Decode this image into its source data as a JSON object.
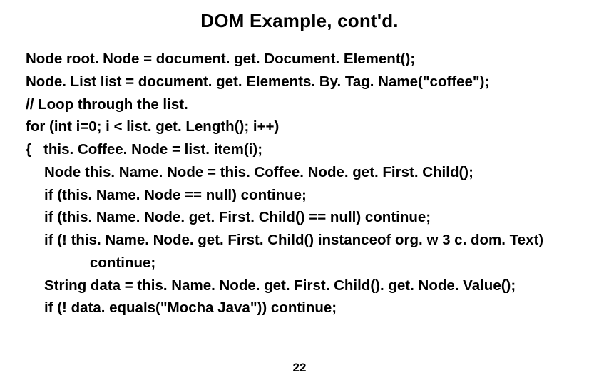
{
  "title": "DOM Example, cont'd.",
  "code": {
    "l0": "Node root. Node = document. get. Document. Element();",
    "l1": "Node. List list = document. get. Elements. By. Tag. Name(\"coffee\");",
    "l2": "// Loop through the list.",
    "l3": "for (int i=0; i < list. get. Length(); i++)",
    "l4": "{   this. Coffee. Node = list. item(i);",
    "l5": "Node this. Name. Node = this. Coffee. Node. get. First. Child();",
    "l6": "if (this. Name. Node == null) continue;",
    "l7": "if (this. Name. Node. get. First. Child() == null) continue;",
    "l8": "if (! this. Name. Node. get. First. Child() instanceof org. w 3 c. dom. Text)",
    "l9": "continue;",
    "l10": "String data = this. Name. Node. get. First. Child(). get. Node. Value();",
    "l11": "if (! data. equals(\"Mocha Java\")) continue;"
  },
  "page_number": "22"
}
